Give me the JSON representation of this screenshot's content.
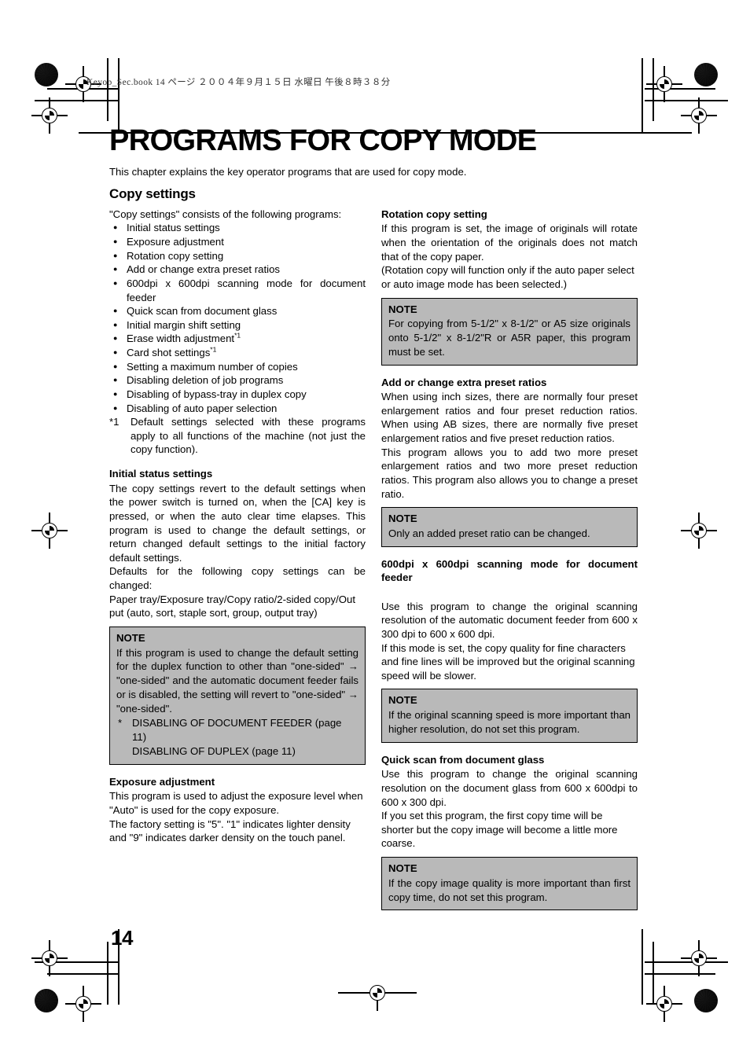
{
  "slug": "Keyop_Sec.book   14 ページ   ２００４年９月１５日   水曜日   午後８時３８分",
  "chapter": {
    "title": "PROGRAMS FOR COPY MODE",
    "intro": "This chapter explains the key operator programs that are used for copy mode.",
    "section_title": "Copy settings"
  },
  "folio": "14",
  "left": {
    "list_intro": "\"Copy settings\" consists of the following programs:",
    "bullets": [
      {
        "text": "Initial status settings",
        "fn": ""
      },
      {
        "text": "Exposure adjustment",
        "fn": ""
      },
      {
        "text": "Rotation copy setting",
        "fn": ""
      },
      {
        "text": "Add or change extra preset ratios",
        "fn": ""
      },
      {
        "text": "600dpi x 600dpi scanning mode for document feeder",
        "fn": ""
      },
      {
        "text": "Quick scan from document glass",
        "fn": ""
      },
      {
        "text": "Initial margin shift setting",
        "fn": ""
      },
      {
        "text": "Erase width adjustment",
        "fn": "*1"
      },
      {
        "text": "Card shot settings",
        "fn": "*1"
      },
      {
        "text": "Setting a maximum number of copies",
        "fn": ""
      },
      {
        "text": "Disabling deletion of job programs",
        "fn": ""
      },
      {
        "text": "Disabling of bypass-tray in duplex copy",
        "fn": ""
      },
      {
        "text": "Disabling of auto paper selection",
        "fn": ""
      }
    ],
    "footnote_marker": "*1",
    "footnote_text": "Default settings selected with these programs apply to all functions of the machine (not just the copy function).",
    "initial_status": {
      "heading": "Initial status settings",
      "para1": "The copy settings revert to the default settings when the power switch is turned on, when the [CA] key is pressed, or when the auto clear time elapses. This program is used to change the default settings, or return changed default settings to the initial factory default settings.",
      "para2": "Defaults for the following copy settings can be changed:",
      "para3": "Paper tray/Exposure tray/Copy ratio/2-sided copy/Out put (auto, sort, staple sort, group, output tray)",
      "note": {
        "label": "NOTE",
        "body": "If this program is used to change the default setting for the duplex function to other than \"one-sided\" → \"one-sided\" and the automatic document feeder fails or is disabled, the setting will revert to \"one-sided\" → \"one-sided\".",
        "extra_star": "*",
        "extra_line1": "DISABLING OF DOCUMENT FEEDER (page 11)",
        "extra_line2": "DISABLING OF DUPLEX (page 11)"
      }
    },
    "exposure": {
      "heading": "Exposure adjustment",
      "para1": "This program is used to adjust the exposure level when \"Auto\" is used for the copy exposure.",
      "para2": "The factory setting is \"5\". \"1\" indicates lighter density and \"9\" indicates darker density on the touch panel."
    }
  },
  "right": {
    "rotation": {
      "heading": "Rotation copy setting",
      "para1": "If this program is set, the image of originals will rotate when the orientation of the originals does not match that of the copy paper.",
      "para2": "(Rotation copy will function only if the auto paper select or auto image mode has been selected.)",
      "note": {
        "label": "NOTE",
        "body": "For copying from 5-1/2\" x 8-1/2\" or A5 size originals onto 5-1/2\" x 8-1/2\"R or A5R paper, this program must be set."
      }
    },
    "preset_ratios": {
      "heading": "Add or change extra preset ratios",
      "para1": "When using inch sizes, there are normally four preset enlargement ratios and four preset reduction ratios. When using AB sizes, there are normally five preset enlargement ratios and five preset reduction ratios.",
      "para2": "This program allows you to add two more preset enlargement ratios and two more preset reduction ratios. This program also allows you to change a preset ratio.",
      "note": {
        "label": "NOTE",
        "body": "Only an added preset ratio can be changed."
      }
    },
    "scanning_600": {
      "heading": "600dpi x 600dpi scanning mode for document feeder",
      "para1": "Use this program to change the original scanning resolution of the automatic document feeder from 600 x 300 dpi to 600 x 600 dpi.",
      "para2": "If this mode is set, the copy quality for fine characters and fine lines will be improved but the original scanning speed will be slower.",
      "note": {
        "label": "NOTE",
        "body": "If the original scanning speed is more important than higher resolution, do not set this program."
      }
    },
    "quick_scan": {
      "heading": "Quick scan from document glass",
      "para1": "Use this program to change the original scanning resolution on the document glass from 600 x 600dpi to 600 x 300 dpi.",
      "para2": "If you set this program, the first copy time will be shorter but the copy image will become a little more coarse.",
      "note": {
        "label": "NOTE",
        "body": "If the copy image quality is more important than first copy time, do not set this program."
      }
    }
  }
}
